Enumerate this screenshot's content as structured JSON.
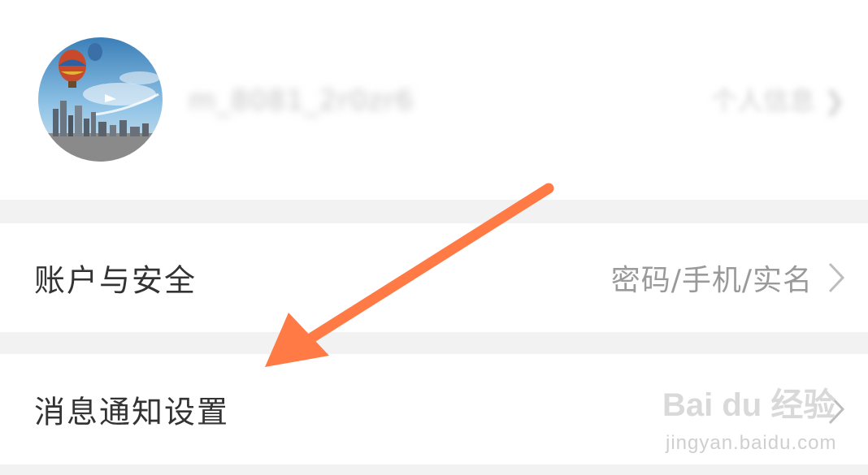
{
  "profile": {
    "username": "m_8081_2r0zr6",
    "link_label": "个人信息"
  },
  "settings": [
    {
      "label": "账户与安全",
      "value": "密码/手机/实名"
    },
    {
      "label": "消息通知设置",
      "value": ""
    }
  ],
  "icons": {
    "avatar": "hot-air-balloon-city-avatar",
    "chevron": "chevron-right-icon"
  },
  "watermark": {
    "logo": "Bai du 经验",
    "url": "jingyan.baidu.com"
  },
  "colors": {
    "annotation_arrow": "#ff7a45",
    "separator": "#f2f2f2",
    "label_text": "#333333",
    "value_text": "#9a9a9a"
  }
}
